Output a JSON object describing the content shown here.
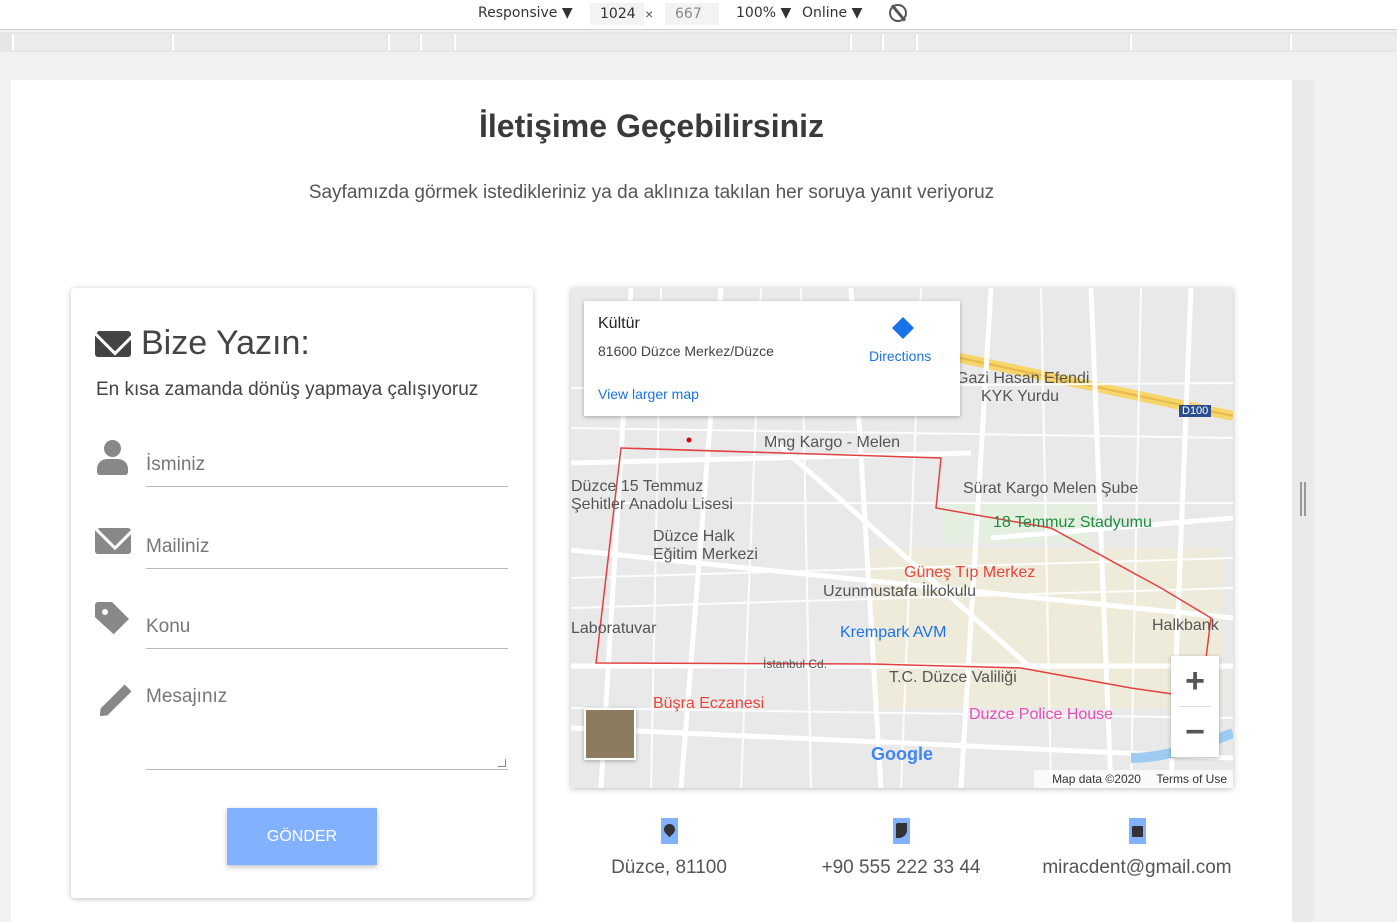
{
  "devtools": {
    "device": "Responsive ▼",
    "width": "1024",
    "height": "667",
    "times": "×",
    "zoom": "100% ▼",
    "network": "Online ▼"
  },
  "page": {
    "title": "İletişime Geçebilirsiniz",
    "subtitle": "Sayfamızda görmek istedikleriniz ya da aklınıza takılan her soruya yanıt veriyoruz"
  },
  "form": {
    "heading": "Bize Yazın:",
    "subheading": "En kısa zamanda dönüş yapmaya çalışıyoruz",
    "name_placeholder": "İsminiz",
    "email_placeholder": "Mailiniz",
    "subject_placeholder": "Konu",
    "message_placeholder": "Mesajınız",
    "submit_label": "GÖNDER",
    "accent": "#82b1ff"
  },
  "map": {
    "place_name": "Kültür",
    "place_address": "81600 Düzce Merkez/Düzce",
    "directions": "Directions",
    "larger_map": "View larger map",
    "zoom_in": "+",
    "zoom_out": "−",
    "google": "Google",
    "map_data": "Map data ©2020",
    "terms": "Terms of Use",
    "labels": {
      "kyk1": "Gazi Hasan Efendi",
      "kyk2": "KYK Yurdu",
      "mng": "Mng Kargo - Melen",
      "surat": "Sürat Kargo Melen Şube",
      "stadium": "18 Temmuz Stadyumu",
      "school1": "Düzce 15 Temmuz",
      "school2": "Şehitler Anadolu Lisesi",
      "halk1": "Düzce Halk",
      "halk2": "Eğitim Merkezi",
      "gunes": "Güneş Tıp Merkez",
      "uzun": "Uzunmustafa İlkokulu",
      "krem": "Krempark AVM",
      "lab": "Laboratuvar",
      "halkbank": "Halkbank",
      "vali": "T.C. Düzce Valiliği",
      "police": "Duzce Police House",
      "busra": "Büşra Eczanesi",
      "istanbul": "İstanbul Cd.",
      "d100": "D100"
    }
  },
  "contact": {
    "address": "Düzce, 81100",
    "phone": "+90 555 222 33 44",
    "email": "miracdent@gmail.com"
  }
}
